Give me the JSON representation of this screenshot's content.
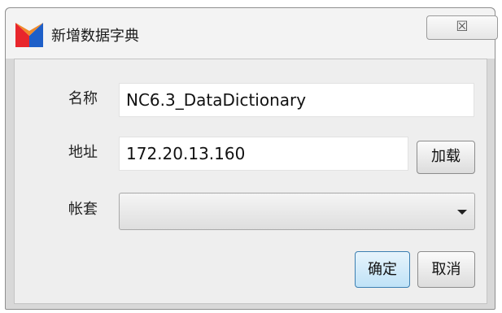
{
  "dialog": {
    "title": "新增数据字典",
    "close_glyph": "☒"
  },
  "form": {
    "name_label": "名称",
    "name_value": "NC6.3_DataDictionary",
    "address_label": "地址",
    "address_value": "172.20.13.160",
    "load_button": "加载",
    "account_label": "帐套",
    "account_value": ""
  },
  "actions": {
    "ok": "确定",
    "cancel": "取消"
  },
  "icons": {
    "app": "app-logo-icon",
    "close": "close-icon",
    "dropdown": "chevron-down-icon"
  },
  "colors": {
    "logo_red": "#e8262c",
    "logo_blue": "#1e5fc8",
    "primary_border": "#3c7fb1"
  }
}
